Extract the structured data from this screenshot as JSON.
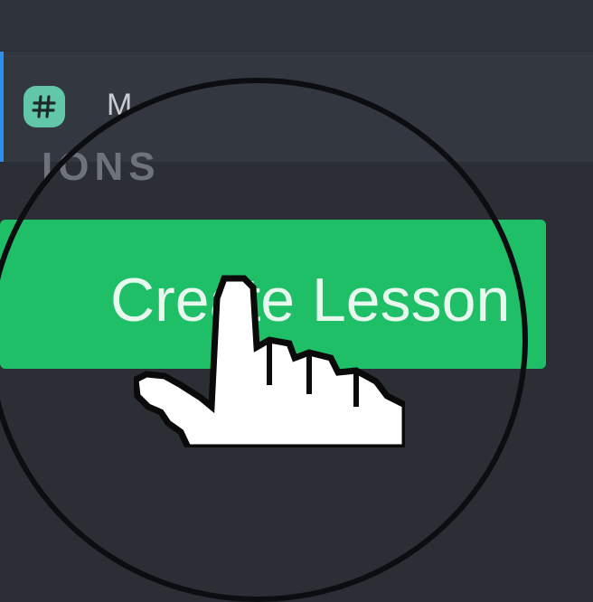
{
  "sidebar": {
    "channel": {
      "label": "M",
      "icon": "hash-icon"
    },
    "section_heading": "IONS"
  },
  "main": {
    "create_lesson_label": "Create Lesson"
  },
  "colors": {
    "background": "#2b2e35",
    "active_row": "#333740",
    "accent": "#2b8ff0",
    "channel_icon": "#62c7a8",
    "button": "#1fbf68"
  },
  "overlay": {
    "magnifier": "magnifier-ring",
    "cursor": "hand-pointer-icon"
  }
}
